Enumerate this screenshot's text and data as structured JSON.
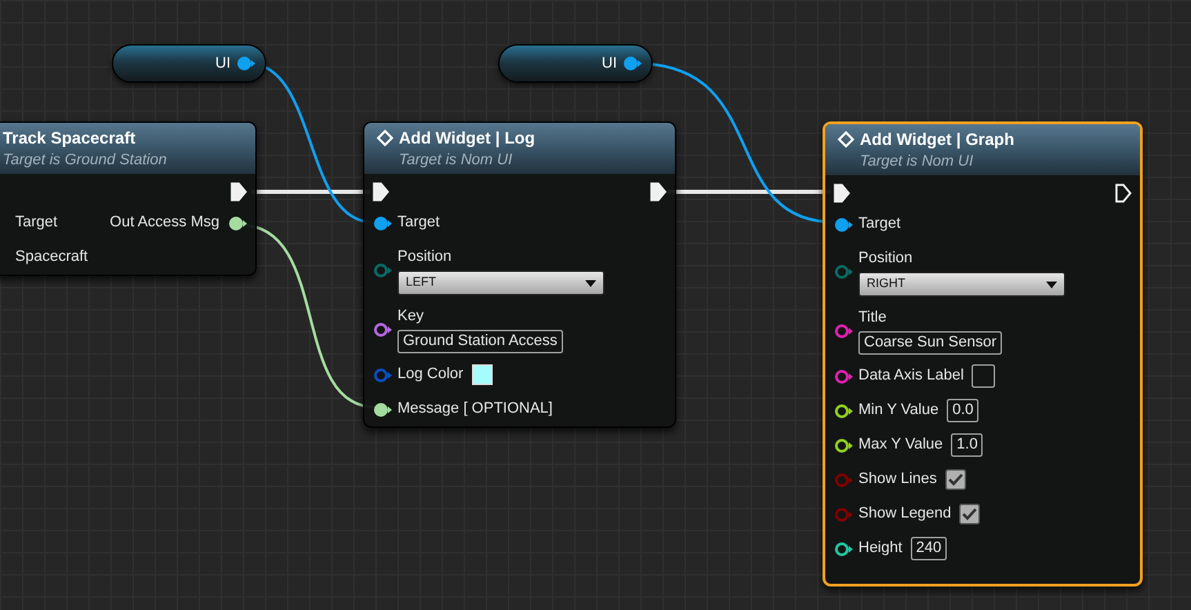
{
  "variable_nodes": [
    {
      "label": "UI",
      "color": "#10a0f0"
    },
    {
      "label": "UI",
      "color": "#10a0f0"
    }
  ],
  "nodes": [
    {
      "title": "Track Spacecraft",
      "subtitle": "Target is Ground Station",
      "selected": false,
      "exec_out": {
        "connected": true
      },
      "inputs": [
        {
          "label": "Target",
          "kind": "plain"
        },
        {
          "label": "Spacecraft",
          "kind": "plain"
        }
      ],
      "outputs": [
        {
          "label": "Out Access Msg",
          "color": "#a4dca0",
          "connected": true
        }
      ]
    },
    {
      "title": "Add Widget | Log",
      "subtitle": "Target is Nom UI",
      "selected": false,
      "exec_in": {
        "connected": true
      },
      "exec_out": {
        "connected": true
      },
      "inputs": [
        {
          "label": "Target",
          "kind": "plain",
          "color": "#10a0f0",
          "connected": true
        },
        {
          "label": "Position",
          "kind": "dropdown",
          "value": "LEFT",
          "color": "#0b6a66",
          "connected": false
        },
        {
          "label": "Key",
          "kind": "entry",
          "value": "Ground Station Access",
          "color": "#b468e0",
          "connected": false
        },
        {
          "label": "Log Color",
          "kind": "swatch",
          "swatch": {
            "color": "#a6fcfc"
          },
          "color": "#0a4fbf",
          "connected": false
        },
        {
          "label": "Message [ OPTIONAL]",
          "kind": "plain",
          "color": "#a4dca0",
          "connected": true
        }
      ]
    },
    {
      "title": "Add Widget | Graph",
      "subtitle": "Target is Nom UI",
      "selected": true,
      "exec_in": {
        "connected": true
      },
      "exec_out": {
        "connected": false
      },
      "inputs": [
        {
          "label": "Target",
          "kind": "plain",
          "color": "#10a0f0",
          "connected": true
        },
        {
          "label": "Position",
          "kind": "dropdown",
          "value": "RIGHT",
          "color": "#0b6a66",
          "connected": false
        },
        {
          "label": "Title",
          "kind": "entry",
          "value": "Coarse Sun Sensor",
          "color": "#e020b0",
          "connected": false
        },
        {
          "label": "Data Axis Label",
          "kind": "text",
          "color": "#e020b0",
          "connected": false
        },
        {
          "label": "Min Y Value",
          "kind": "text",
          "value": "0.0",
          "color": "#90d020",
          "connected": false
        },
        {
          "label": "Max Y Value",
          "kind": "text",
          "value": "1.0",
          "color": "#90d020",
          "connected": false
        },
        {
          "label": "Show Lines",
          "kind": "checkbox",
          "checked": true,
          "color": "#800000",
          "connected": false
        },
        {
          "label": "Show Legend",
          "kind": "checkbox",
          "checked": true,
          "color": "#800000",
          "connected": false
        },
        {
          "label": "Height",
          "kind": "text",
          "value": "240",
          "color": "#20c8a0",
          "connected": false
        }
      ]
    }
  ]
}
